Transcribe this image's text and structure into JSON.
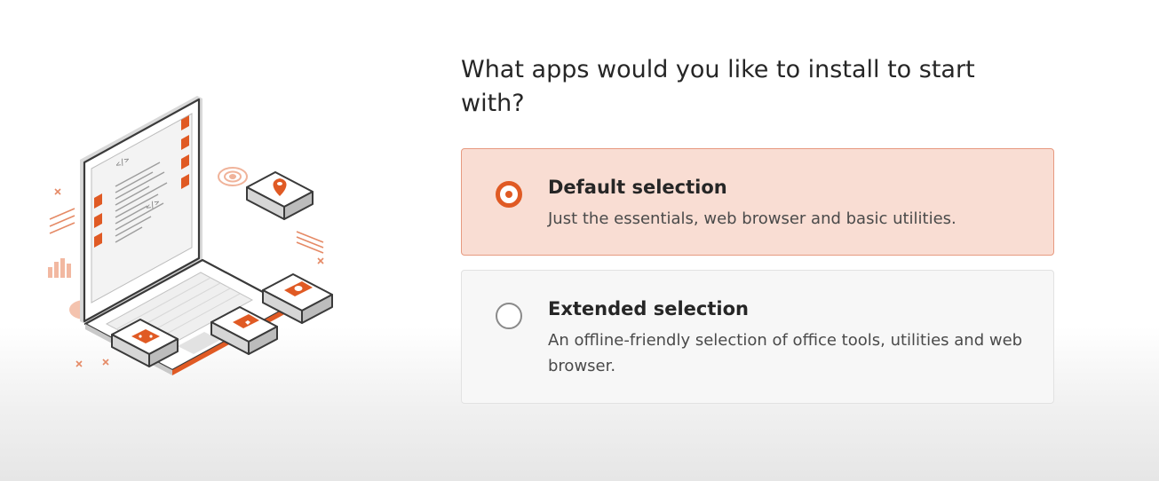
{
  "question": "What apps would you like to install to start with?",
  "options": [
    {
      "title": "Default selection",
      "description": "Just the essentials, web browser and basic utilities.",
      "selected": true
    },
    {
      "title": "Extended selection",
      "description": "An offline-friendly selection of office tools, utilities and web browser.",
      "selected": false
    }
  ],
  "illustration": {
    "code_tag_glyph": "</>"
  },
  "colors": {
    "accent": "#e05a24",
    "selected_bg": "#f9ddd3",
    "selected_border": "#e79a80",
    "unselected_bg": "#f7f7f7"
  }
}
